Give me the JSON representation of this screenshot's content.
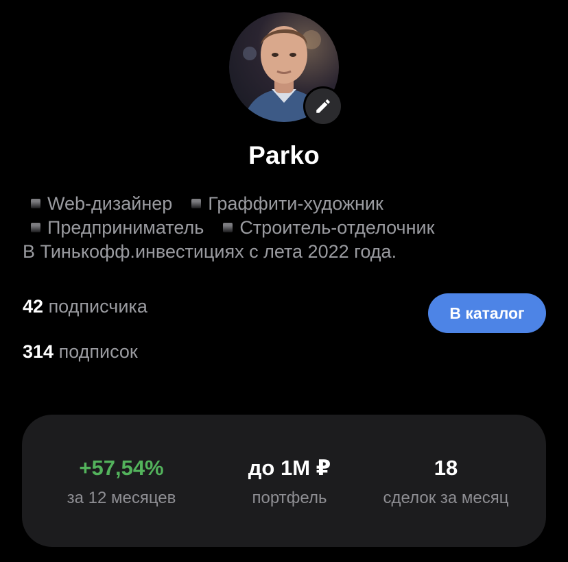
{
  "profile": {
    "username": "Parko",
    "avatar_icon": "user-photo",
    "edit_icon": "pencil-icon",
    "tags": [
      {
        "label": "Web-дизайнер"
      },
      {
        "label": "Граффити-художник"
      },
      {
        "label": "Предприниматель"
      },
      {
        "label": "Строитель-отделочник"
      }
    ],
    "bio_text": "В Тинькофф.инвестициях с лета 2022 года."
  },
  "stats": {
    "followers_count": "42",
    "followers_label": "подписчика",
    "following_count": "314",
    "following_label": "подписок"
  },
  "actions": {
    "catalog_label": "В каталог"
  },
  "metrics": [
    {
      "value": "+57,54%",
      "label": "за 12 месяцев"
    },
    {
      "value": "до 1М ₽",
      "label": "портфель"
    },
    {
      "value": "18",
      "label": "сделок за месяц"
    }
  ],
  "colors": {
    "background": "#000000",
    "accent": "#4d84e6",
    "positive": "#53b35c",
    "card": "#1c1c1e",
    "muted_text": "#9a9ba0"
  }
}
